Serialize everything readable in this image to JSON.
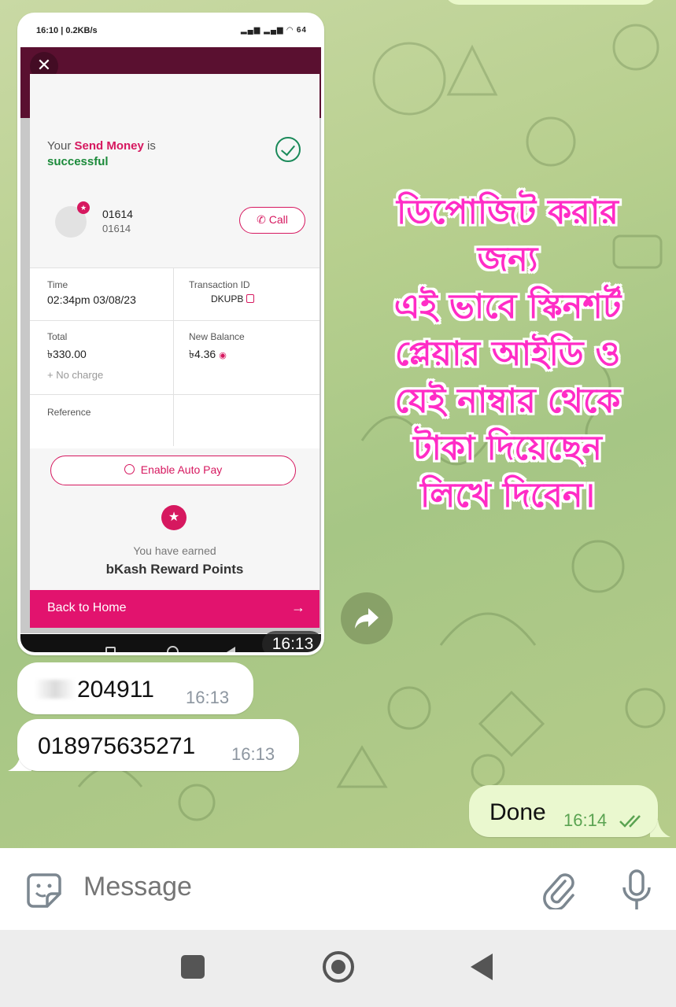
{
  "screenshot": {
    "status_bar": {
      "left": "16:10 | 0.2KB/s",
      "right": "64"
    },
    "success_prefix": "Your ",
    "success_highlight": "Send Money",
    "success_mid": " is",
    "success_status": "successful",
    "account_line1": "01614",
    "account_line2": "01614",
    "call_label": "Call",
    "time_label": "Time",
    "time_value": "02:34pm 03/08/23",
    "txid_label": "Transaction ID",
    "txid_value": "DKUPB",
    "total_label": "Total",
    "total_value": "৳330.00",
    "charge_note": "+ No charge",
    "balance_label": "New Balance",
    "balance_value": "৳4.36",
    "reference_label": "Reference",
    "autopay_label": "Enable Auto Pay",
    "earned_text": "You have earned",
    "points_text": "bKash Reward Points",
    "back_home": "Back to Home",
    "image_time": "16:13"
  },
  "sticker_lines": [
    "ডিপোজিট করার",
    "জন্য",
    "এই ভাবে স্কিনশর্ট",
    "প্লেয়ার আইডি ও",
    "যেই নাম্বার থেকে",
    "টাকা দিয়েছেন",
    "লিখে দিবেন।"
  ],
  "messages": [
    {
      "text": "204911",
      "time": "16:13",
      "direction": "in"
    },
    {
      "text": "018975635271",
      "time": "16:13",
      "direction": "in"
    },
    {
      "text": "Done",
      "time": "16:14",
      "direction": "out"
    }
  ],
  "input": {
    "placeholder": "Message"
  },
  "icons": {
    "sticker": "sticker-icon",
    "attach": "paperclip-icon",
    "mic": "microphone-icon",
    "forward": "forward-icon",
    "read": "double-check-icon"
  },
  "colors": {
    "bkash_pink": "#e2136e",
    "outgoing_bubble": "#eaf8cf",
    "read_check": "#5aa351"
  }
}
